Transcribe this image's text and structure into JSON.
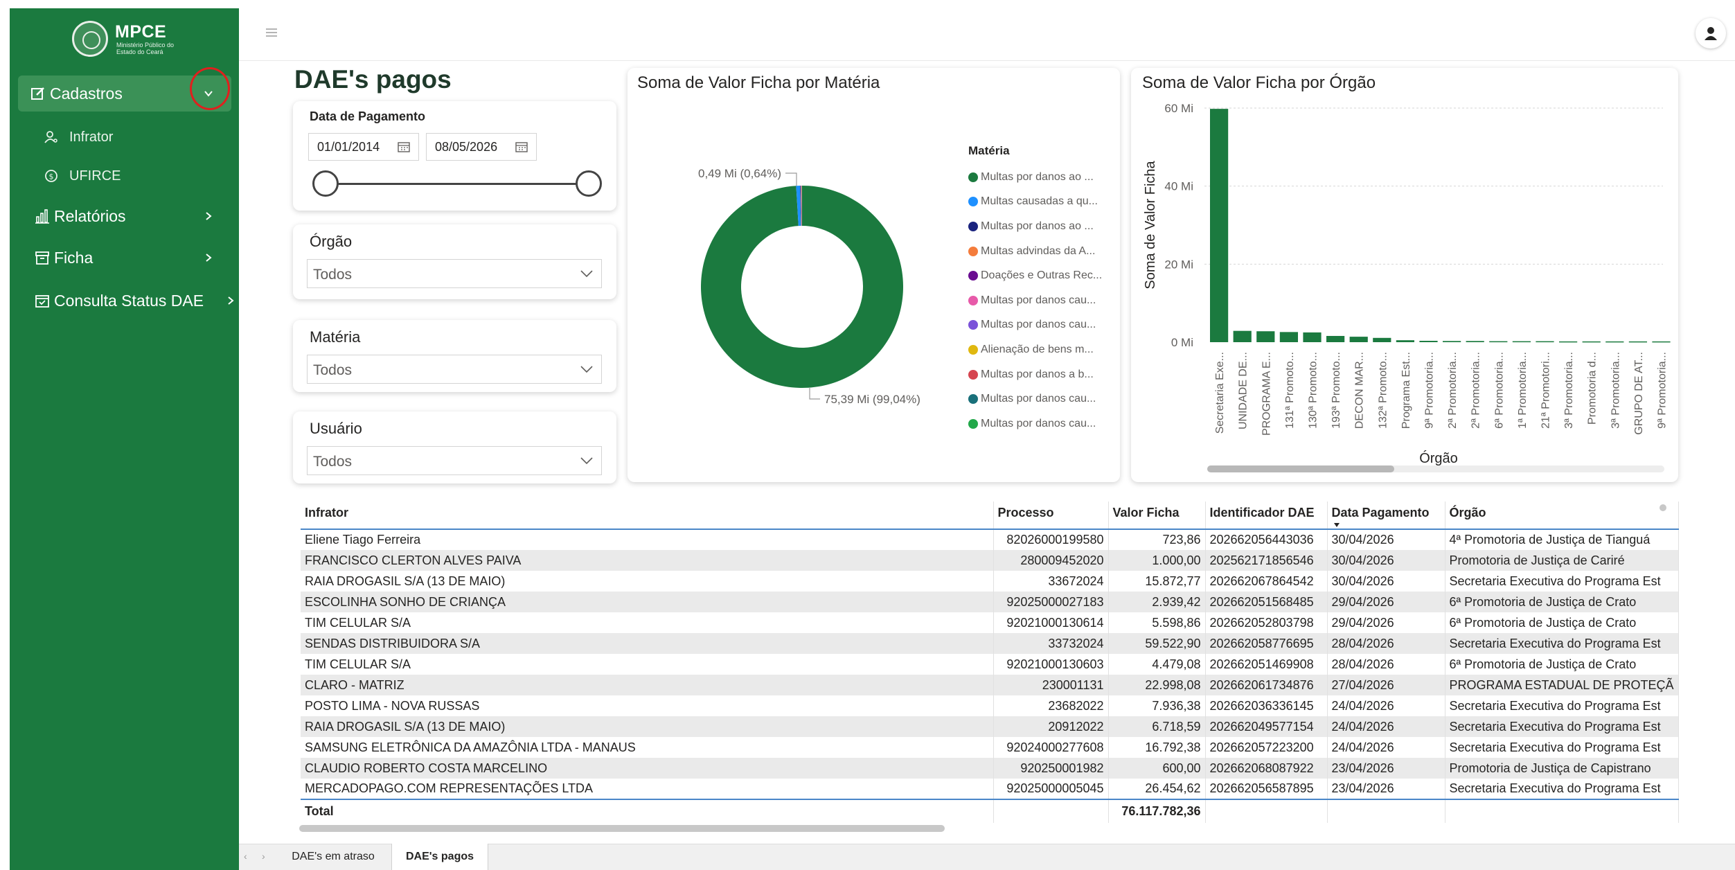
{
  "sidebar": {
    "logo_title": "MPCE",
    "logo_subtitle": "Ministério Público do Estado do Ceará",
    "items": [
      {
        "label": "Cadastros",
        "icon": "edit-icon",
        "expanded": true
      },
      {
        "label": "Infrator",
        "icon": "user-key-icon"
      },
      {
        "label": "UFIRCE",
        "icon": "coin-icon"
      },
      {
        "label": "Relatórios",
        "icon": "bar-chart-icon"
      },
      {
        "label": "Ficha",
        "icon": "archive-icon"
      },
      {
        "label": "Consulta Status DAE",
        "icon": "calendar-check-icon"
      }
    ]
  },
  "report": {
    "title": "DAE's pagos",
    "filters": {
      "date_label": "Data de Pagamento",
      "date_start": "01/01/2014",
      "date_end": "08/05/2026",
      "orgao_label": "Órgão",
      "orgao_value": "Todos",
      "materia_label": "Matéria",
      "materia_value": "Todos",
      "usuario_label": "Usuário",
      "usuario_value": "Todos"
    }
  },
  "chart_data": [
    {
      "type": "pie",
      "title": "Soma de Valor Ficha por Matéria",
      "legend_title": "Matéria",
      "legend_position": "right",
      "labels": [
        "Multas por danos ao ...",
        "Multas causadas a qu...",
        "Multas por danos ao ...",
        "Multas advindas da A...",
        "Doações e Outras Rec...",
        "Multas por danos cau...",
        "Multas por danos cau...",
        "Alienação de bens m...",
        "Multas por danos a b...",
        "Multas por danos cau...",
        "Multas por danos cau..."
      ],
      "colors": [
        "#1b7a3f",
        "#1e90ff",
        "#1a237e",
        "#f47c3c",
        "#6a0d91",
        "#e75aa9",
        "#7b52d9",
        "#e0b80f",
        "#d64550",
        "#19707a",
        "#22a84a"
      ],
      "values": [
        75.39,
        0.49,
        0.05,
        0.04,
        0.03,
        0.03,
        0.02,
        0.02,
        0.01,
        0.01,
        0.01
      ],
      "data_labels": [
        "75,39 Mi (99,04%)",
        "0,49 Mi (0,64%)"
      ]
    },
    {
      "type": "bar",
      "title": "Soma de Valor Ficha por Órgão",
      "xlabel": "Órgão",
      "ylabel": "Soma de Valor Ficha",
      "ylim": [
        0,
        60
      ],
      "yticks": [
        "0 Mi",
        "20 Mi",
        "40 Mi",
        "60 Mi"
      ],
      "grid": true,
      "color": "#1b7a3f",
      "categories": [
        "Secretaria Exe...",
        "UNIDADE DE...",
        "PROGRAMA E...",
        "131ª Promoto...",
        "130ª Promoto...",
        "193ª Promoto...",
        "DECON MAR...",
        "132ª Promoto...",
        "Programa Est...",
        "9ª Promotoria...",
        "2ª Promotoria...",
        "2ª Promotoria...",
        "6ª Promotoria...",
        "1ª Promotoria...",
        "21ª Promotori...",
        "3ª Promotoria...",
        "Promotoria d...",
        "3ª Promotoria...",
        "GRUPO DE AT...",
        "9ª Promotoria..."
      ],
      "values": [
        59.8,
        2.9,
        2.8,
        2.6,
        2.5,
        1.6,
        1.4,
        1.1,
        0.5,
        0.35,
        0.3,
        0.3,
        0.25,
        0.25,
        0.25,
        0.2,
        0.2,
        0.2,
        0.2,
        0.2
      ]
    }
  ],
  "table": {
    "columns": [
      "Infrator",
      "Processo",
      "Valor Ficha",
      "Identificador DAE",
      "Data Pagamento",
      "Órgão"
    ],
    "rows": [
      [
        "Eliene Tiago Ferreira",
        "82026000199580",
        "723,86",
        "202662056443036",
        "30/04/2026",
        "4ª Promotoria de Justiça de Tianguá"
      ],
      [
        "FRANCISCO CLERTON ALVES PAIVA",
        "280009452020",
        "1.000,00",
        "202562171856546",
        "30/04/2026",
        "Promotoria de Justiça de Cariré"
      ],
      [
        "RAIA DROGASIL S/A (13 DE MAIO)",
        "33672024",
        "15.872,77",
        "202662067864542",
        "30/04/2026",
        "Secretaria Executiva do Programa Est"
      ],
      [
        "ESCOLINHA SONHO DE CRIANÇA",
        "92025000027183",
        "2.939,42",
        "202662051568485",
        "29/04/2026",
        "6ª Promotoria de Justiça de Crato"
      ],
      [
        "TIM CELULAR S/A",
        "92021000130614",
        "5.598,86",
        "202662052803798",
        "29/04/2026",
        "6ª Promotoria de Justiça de Crato"
      ],
      [
        "SENDAS DISTRIBUIDORA S/A",
        "33732024",
        "59.522,90",
        "202662058776695",
        "28/04/2026",
        "Secretaria Executiva do Programa Est"
      ],
      [
        "TIM CELULAR S/A",
        "92021000130603",
        "4.479,08",
        "202662051469908",
        "28/04/2026",
        "6ª Promotoria de Justiça de Crato"
      ],
      [
        "CLARO - MATRIZ",
        "230001131",
        "22.998,08",
        "202662061734876",
        "27/04/2026",
        "PROGRAMA ESTADUAL DE PROTEÇÃ"
      ],
      [
        "POSTO LIMA - NOVA RUSSAS",
        "23682022",
        "7.936,38",
        "202662036336145",
        "24/04/2026",
        "Secretaria Executiva do Programa Est"
      ],
      [
        "RAIA DROGASIL S/A (13 DE MAIO)",
        "20912022",
        "6.718,59",
        "202662049577154",
        "24/04/2026",
        "Secretaria Executiva do Programa Est"
      ],
      [
        "SAMSUNG ELETRÔNICA DA AMAZÔNIA LTDA - MANAUS",
        "92024000277608",
        "16.792,38",
        "202662057223200",
        "24/04/2026",
        "Secretaria Executiva do Programa Est"
      ],
      [
        "CLAUDIO ROBERTO COSTA MARCELINO",
        "920250001982",
        "600,00",
        "202662068087922",
        "23/04/2026",
        "Promotoria de Justiça de Capistrano"
      ],
      [
        "MERCADOPAGO.COM REPRESENTAÇÕES LTDA",
        "92025000005045",
        "26.454,62",
        "202662056587895",
        "23/04/2026",
        "Secretaria Executiva do Programa Est"
      ]
    ],
    "total_label": "Total",
    "total_value": "76.117.782,36"
  },
  "tabs": [
    "DAE's em atraso",
    "DAE's pagos"
  ],
  "active_tab": "DAE's pagos"
}
